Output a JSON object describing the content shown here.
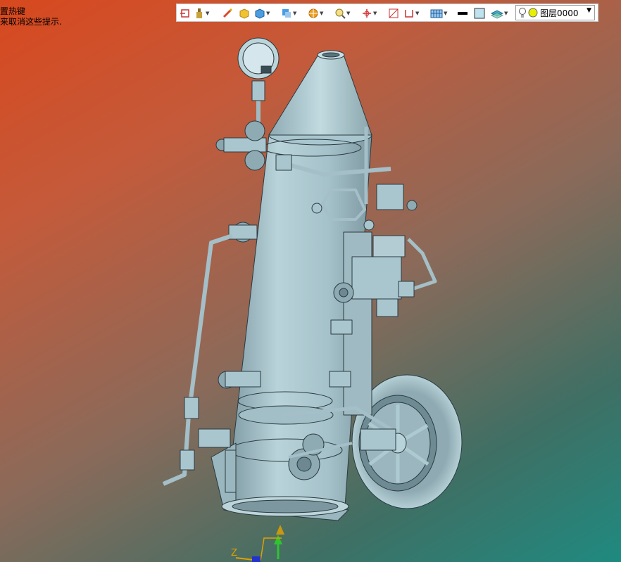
{
  "status_hint": {
    "line1": "置热键",
    "line2": "来取消这些提示."
  },
  "toolbar": {
    "icons": [
      "entry-icon",
      "paint-bucket-icon",
      "pencil-icon",
      "cube-shaded-icon",
      "cube-view-icon",
      "view-orient-icon",
      "render-style-icon",
      "zoom-fit-icon",
      "axis-snap-icon",
      "section-icon",
      "dimension-icon",
      "grid-display-icon",
      "line-color-icon",
      "fill-color-icon",
      "layer-stack-icon"
    ],
    "layer_selector": {
      "value": "图层0000",
      "icons": [
        "lightbulb-icon",
        "layer-color-dot-icon"
      ]
    }
  },
  "triad": {
    "z_label": "Z"
  },
  "colors": {
    "model_fill": "#a9c6cf",
    "model_edge": "#2b3a40",
    "triad_green": "#2ec52e",
    "triad_orange": "#e0a000",
    "triad_blue": "#2233cc"
  }
}
